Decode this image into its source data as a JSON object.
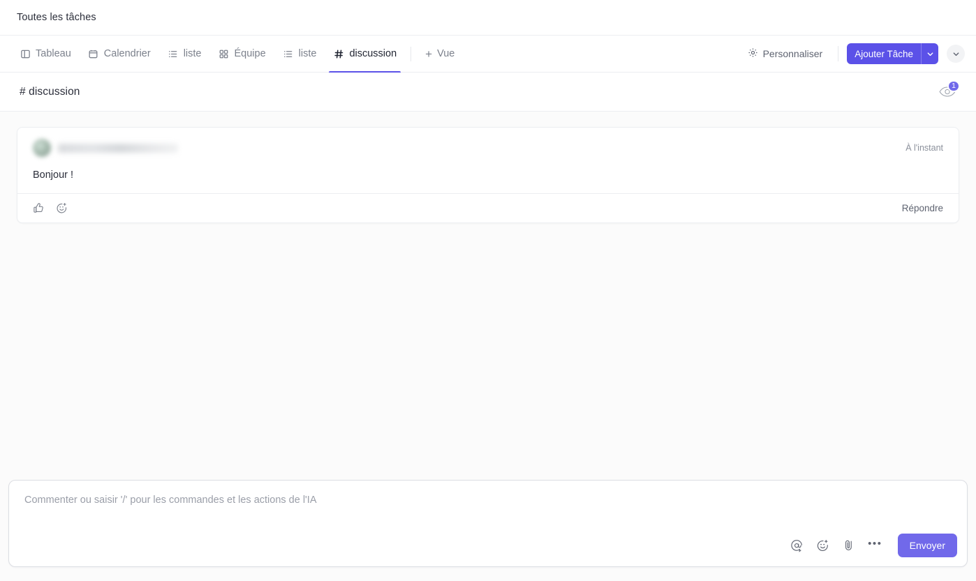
{
  "breadcrumb": {
    "label": "Toutes les tâches"
  },
  "colors": {
    "accent": "#5b51e8",
    "accent_light": "#7169ea",
    "page_bg": "#fbfbfb",
    "text": "#2b2e3a",
    "muted": "#7c818c",
    "border": "#eceef1"
  },
  "tabbar": {
    "tabs": [
      {
        "label": "Tableau",
        "icon": "board-icon",
        "active": false
      },
      {
        "label": "Calendrier",
        "icon": "calendar-icon",
        "active": false
      },
      {
        "label": "liste",
        "icon": "list-icon",
        "active": false
      },
      {
        "label": "Équipe",
        "icon": "grid-icon",
        "active": false
      },
      {
        "label": "liste",
        "icon": "list-icon",
        "active": false
      },
      {
        "label": "discussion",
        "icon": "hash-icon",
        "active": true
      }
    ],
    "add_view": {
      "label": "Vue",
      "plus": "+"
    },
    "customize": {
      "label": "Personnaliser",
      "icon": "gear-icon"
    },
    "add_task": {
      "label": "Ajouter Tâche",
      "caret": "chevron-down-icon"
    },
    "more_caret": "chevron-down-icon"
  },
  "channel": {
    "hash": "#",
    "title": "discussion",
    "watchers": {
      "icon": "eye-icon",
      "count": "1"
    }
  },
  "message": {
    "author": "",
    "time": "À l'instant",
    "text": "Bonjour !",
    "reactions": [
      {
        "name": "thumbs-up-icon"
      },
      {
        "name": "add-reaction-icon"
      }
    ],
    "reply_label": "Répondre"
  },
  "composer": {
    "value": "",
    "placeholder": "Commenter ou saisir '/' pour les commandes et les actions de l'IA",
    "tools": [
      {
        "name": "mention-icon"
      },
      {
        "name": "emoji-icon"
      },
      {
        "name": "attachment-icon"
      },
      {
        "name": "more-options-icon"
      }
    ],
    "more_glyph": "•••",
    "send_label": "Envoyer"
  }
}
